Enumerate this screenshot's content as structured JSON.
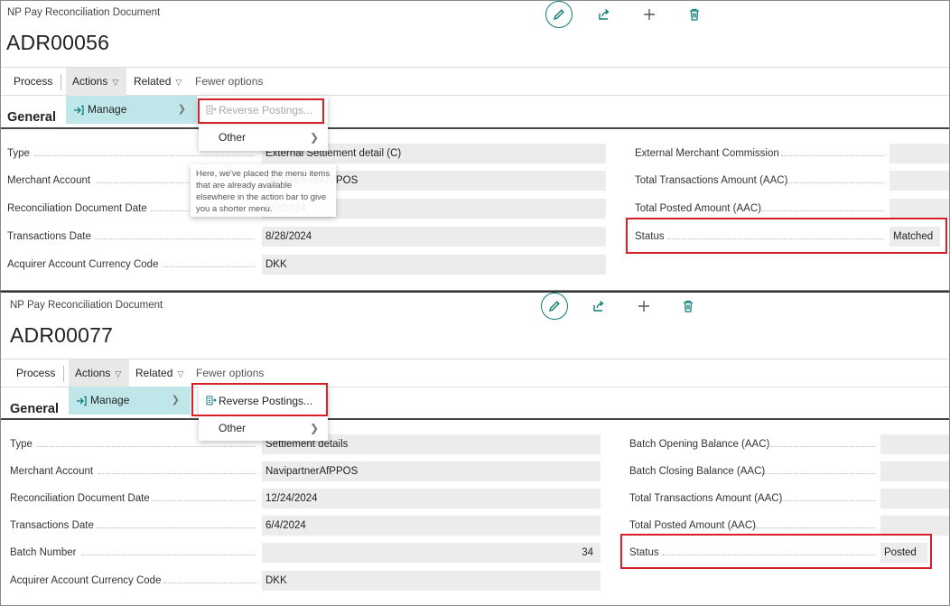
{
  "panel1": {
    "caption": "NP Pay Reconciliation Document",
    "doc_no": "ADR00056",
    "actionbar": {
      "process": "Process",
      "actions": "Actions",
      "related": "Related",
      "fewer": "Fewer options"
    },
    "manage_label": "Manage",
    "submenu": {
      "reverse": "Reverse Postings...",
      "other": "Other"
    },
    "tooltip": "Here, we've placed the menu items that are already available elsewhere in the action bar to give you a shorter menu.",
    "section": "General",
    "left_fields": [
      {
        "label": "Type",
        "value": "External Settlement detail (C)"
      },
      {
        "label": "Merchant Account",
        "value": "NavipartnerAfPPOS"
      },
      {
        "label": "Reconciliation Document Date",
        "value": "9/2/2024"
      },
      {
        "label": "Transactions Date",
        "value": "8/28/2024"
      },
      {
        "label": "Acquirer Account Currency Code",
        "value": "DKK"
      }
    ],
    "right_fields": [
      {
        "label": "External Merchant Commission",
        "value": ""
      },
      {
        "label": "Total Transactions Amount (AAC)",
        "value": ""
      },
      {
        "label": "Total Posted Amount (AAC)",
        "value": ""
      },
      {
        "label": "Status",
        "value": "Matched"
      }
    ]
  },
  "panel2": {
    "caption": "NP Pay Reconciliation Document",
    "doc_no": "ADR00077",
    "actionbar": {
      "process": "Process",
      "actions": "Actions",
      "related": "Related",
      "fewer": "Fewer options"
    },
    "manage_label": "Manage",
    "submenu": {
      "reverse": "Reverse Postings...",
      "other": "Other"
    },
    "section": "General",
    "left_fields": [
      {
        "label": "Type",
        "value": "Settlement details"
      },
      {
        "label": "Merchant Account",
        "value": "NavipartnerAfPPOS"
      },
      {
        "label": "Reconciliation Document Date",
        "value": "12/24/2024"
      },
      {
        "label": "Transactions Date",
        "value": "6/4/2024"
      },
      {
        "label": "Batch Number",
        "value": "34"
      },
      {
        "label": "Acquirer Account Currency Code",
        "value": "DKK"
      }
    ],
    "right_fields": [
      {
        "label": "Batch Opening Balance (AAC)",
        "value": ""
      },
      {
        "label": "Batch Closing Balance (AAC)",
        "value": ""
      },
      {
        "label": "Total Transactions Amount (AAC)",
        "value": ""
      },
      {
        "label": "Total Posted Amount (AAC)",
        "value": ""
      },
      {
        "label": "Status",
        "value": "Posted"
      }
    ]
  },
  "colors": {
    "accent": "#0e7d77",
    "manage_bg": "#bfe7ea",
    "highlight": "#d8202a"
  },
  "icons": [
    "edit-icon",
    "share-icon",
    "add-icon",
    "delete-icon",
    "manage-icon",
    "reverse-postings-icon",
    "chevron-right-icon",
    "chevron-down-icon"
  ]
}
